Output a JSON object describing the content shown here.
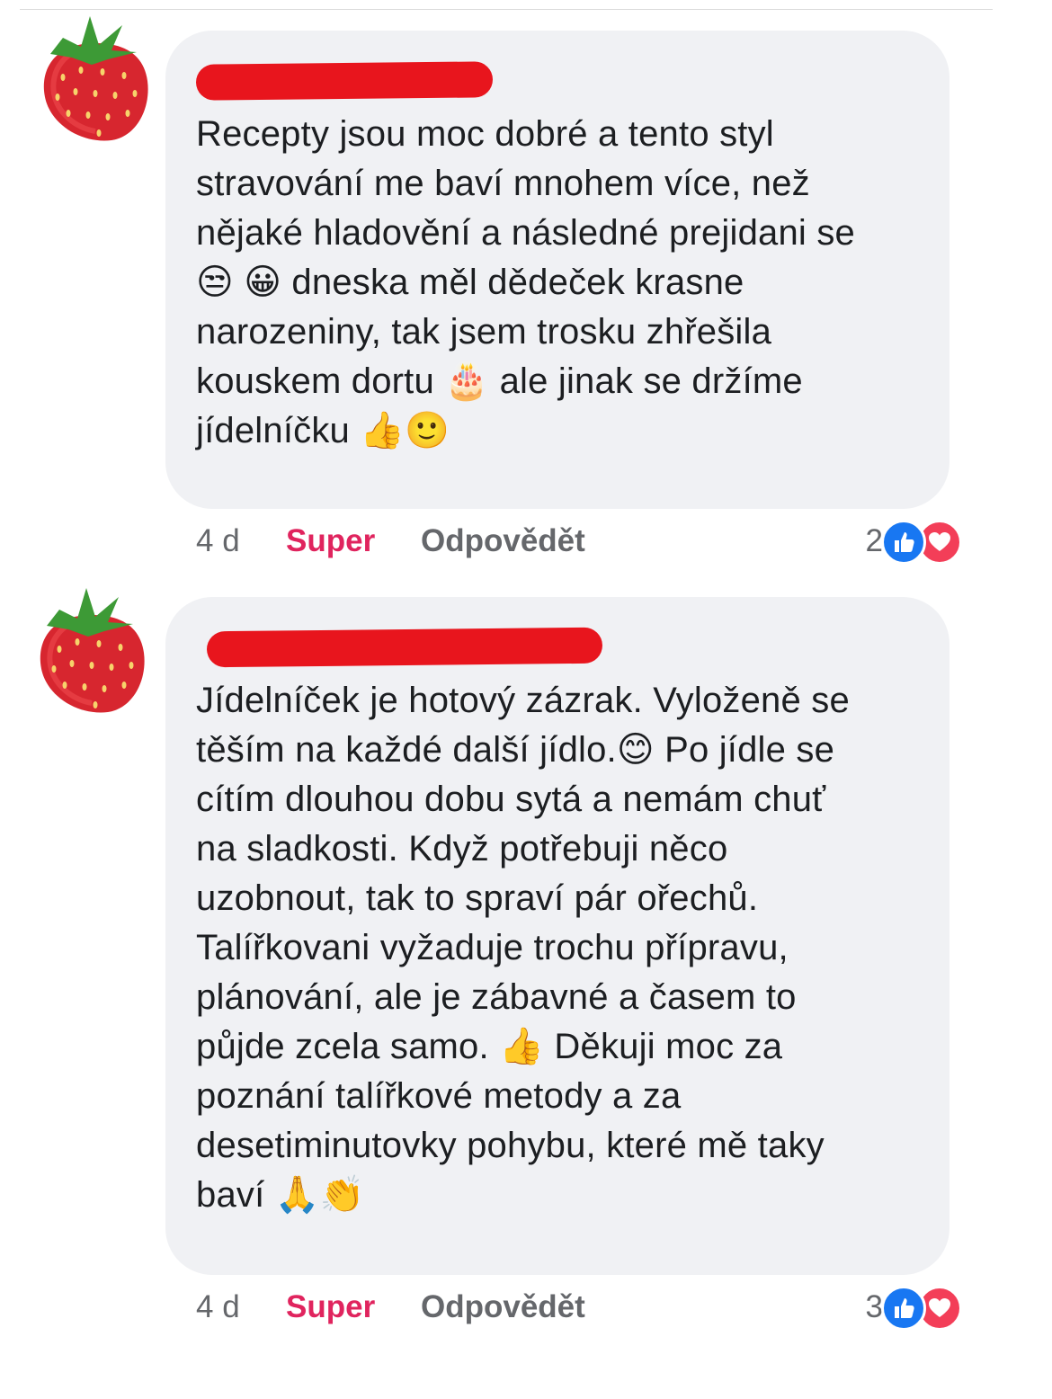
{
  "colors": {
    "bubble_bg": "#f0f1f4",
    "text": "#1c1e21",
    "meta_text": "#65676b",
    "reaction_label": "#e0245e",
    "redaction": "#e8151d",
    "like_blue": "#1877f2",
    "love_red": "#f33e58"
  },
  "comments": [
    {
      "avatar_icon": "strawberry-icon",
      "author_redacted": true,
      "text": "Recepty jsou moc dobré a tento styl\nstravování me baví mnohem více, než\nnějaké hladovění a následné prejidani se\n😒 😀 dneska měl dědeček krasne\nnarozeniny, tak jsem trosku zhřešila\nkouskem dortu 🎂 ale jinak se držíme\njídelníčku  👍🙂",
      "time": "4 d",
      "reaction_label": "Super",
      "reply_label": "Odpovědět",
      "reaction_count": "2",
      "reaction_icons": [
        "like-icon",
        "love-icon"
      ]
    },
    {
      "avatar_icon": "strawberry-icon",
      "author_redacted": true,
      "text": "Jídelníček je hotový zázrak. Vyloženě se\ntěším na každé další jídlo.😊 Po jídle se\ncítím dlouhou dobu sytá a nemám chuť\nna sladkosti. Když potřebuji něco\nuzobnout, tak to spraví pár ořechů.\nTalířkovani vyžaduje trochu přípravu,\nplánování, ale je zábavné a časem to\npůjde zcela samo. 👍 Děkuji moc za\npoznání talířkové metody a za\ndesetiminutovky pohybu, které mě taky\nbaví 🙏👏",
      "time": "4 d",
      "reaction_label": "Super",
      "reply_label": "Odpovědět",
      "reaction_count": "3",
      "reaction_icons": [
        "like-icon",
        "love-icon"
      ]
    }
  ]
}
